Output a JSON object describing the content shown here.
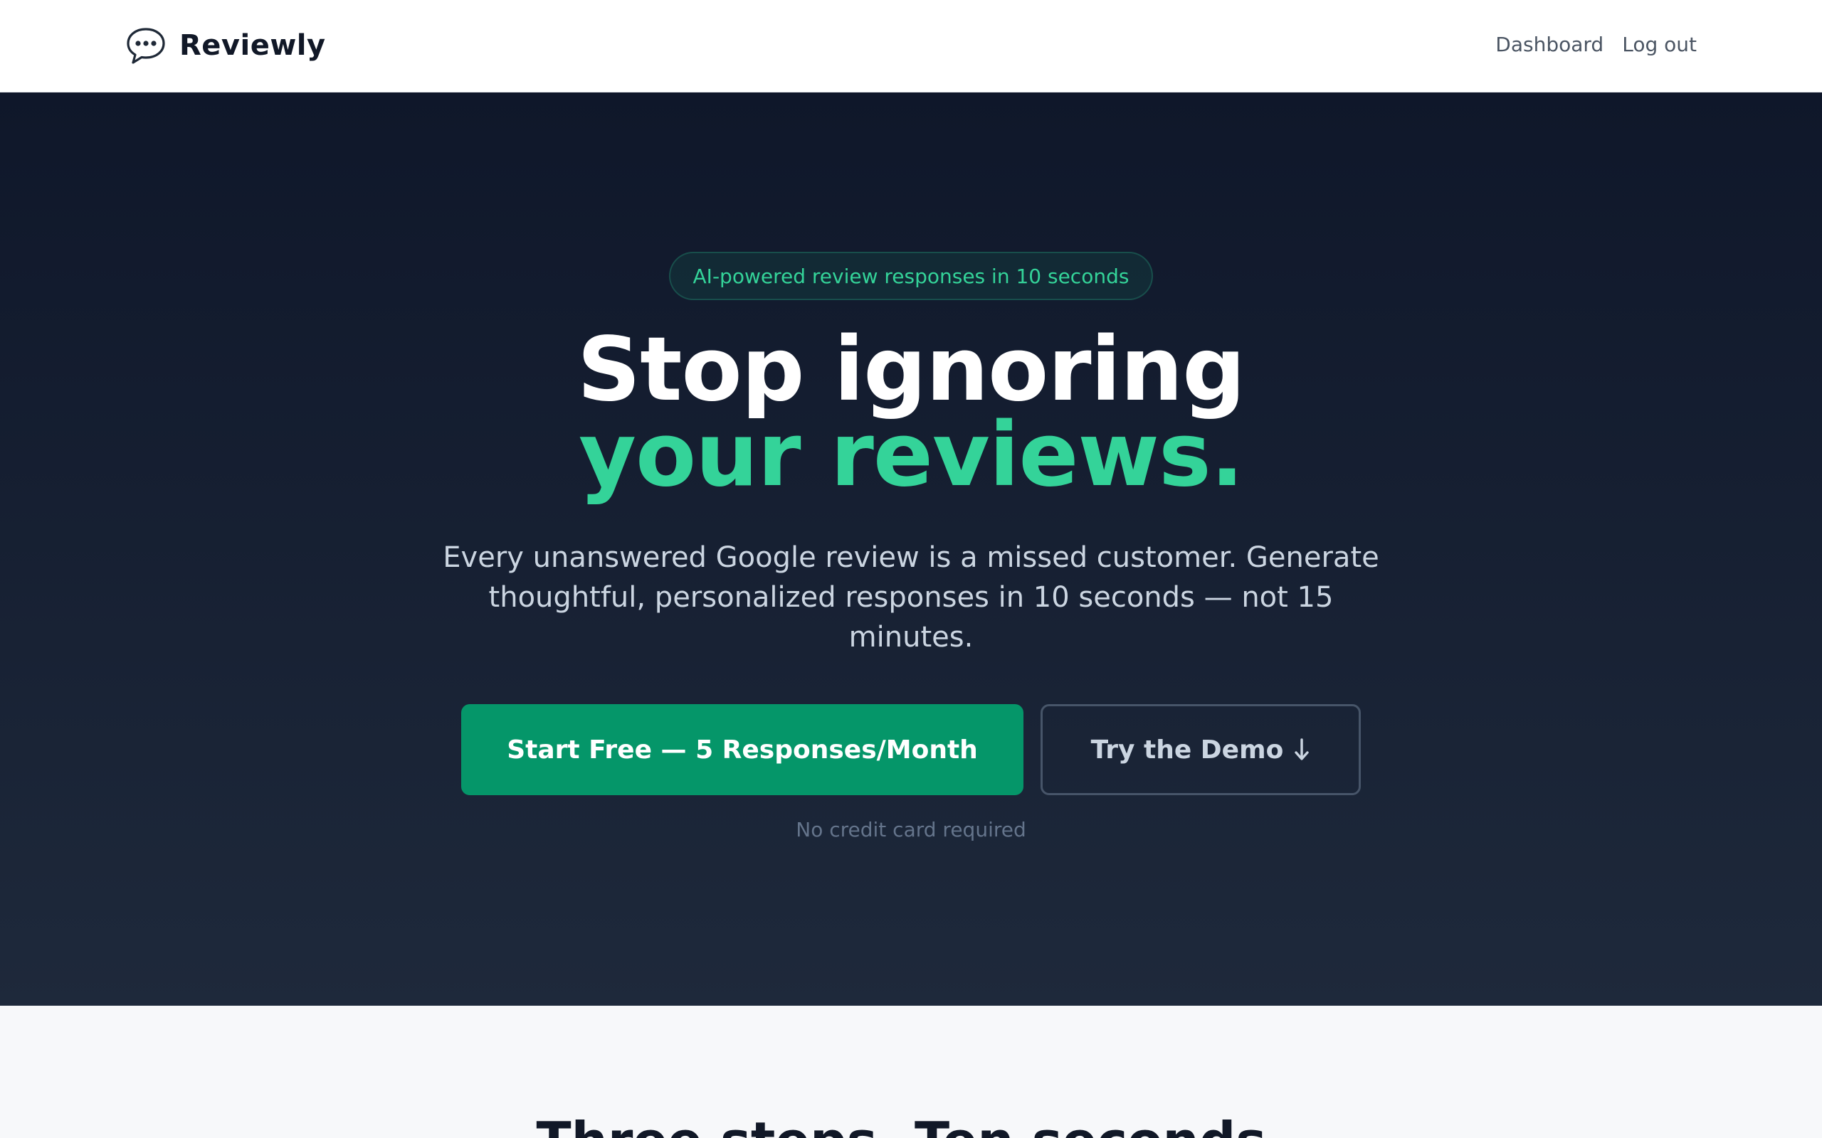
{
  "header": {
    "brand_name": "Reviewly",
    "brand_icon": "speech-bubble-icon",
    "nav": {
      "dashboard_label": "Dashboard",
      "logout_label": "Log out"
    }
  },
  "hero": {
    "pill_text": "AI-powered review responses in 10 seconds",
    "headline_line1": "Stop ignoring",
    "headline_line2": "your reviews.",
    "subtext": "Every unanswered Google review is a missed customer. Generate thoughtful, personalized responses in 10 seconds — not 15 minutes.",
    "primary_cta_label": "Start Free — 5 Responses/Month",
    "secondary_cta_label": "Try the Demo",
    "secondary_cta_icon": "arrow-down-icon",
    "note": "No credit card required"
  },
  "section": {
    "title": "Three steps. Ten seconds."
  },
  "colors": {
    "brand_green": "#34d399",
    "cta_green": "#059669",
    "hero_bg_top": "#0f172a",
    "hero_bg_bottom": "#1e293b"
  }
}
